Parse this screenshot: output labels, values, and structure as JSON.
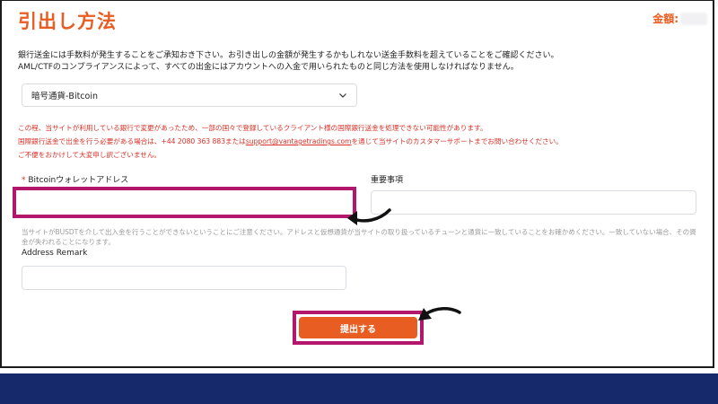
{
  "page": {
    "title": "引出し方法",
    "amount_label": "金額:"
  },
  "notice": {
    "line1": "銀行送金には手数料が発生することをご承知おき下さい。お引き出しの金額が発生するかもしれない送金手数料を超えていることをご確認ください。",
    "line2": "AML/CTFのコンプライアンスによって、すべての出金にはアカウントへの入金で用いられたものと同じ方法を使用しなければなりません。"
  },
  "method_select": {
    "value": "暗号通貨-Bitcoin",
    "icon": "chevron-down-icon"
  },
  "warning": {
    "line1": "この程、当サイトが利用している銀行で変更があったため、一部の国々で登録しているクライアント様の国際銀行送金を処理できない可能性があります。",
    "line2_prefix": "国際銀行送金で出金を行う必要がある場合は、+44 2080 363 883または",
    "email": "support@vantagetradings.com",
    "line2_suffix": "を通じて当サイトのカスタマーサポートまでお問い合わせください。",
    "line3": "ご不便をおかけして大変申し訳ございません。"
  },
  "form": {
    "wallet_required_mark": "*",
    "wallet_label": "Bitcoinウォレットアドレス",
    "wallet_value": "",
    "memo_label": "重要事項",
    "memo_value": "",
    "helper_text": "当サイトがBUSDTを介して出入金を行うことができないということにご注意ください。アドレスと仮想通貨が当サイトの取り扱っているチューンと通貨に一致していることをお確かめください。一致していない場合、その資金が失われることになります。",
    "remark_label": "Address Remark",
    "remark_value": "",
    "submit_label": "提出する"
  },
  "colors": {
    "accent": "#e85d22",
    "highlight": "#b3176c",
    "warning": "#d93026",
    "footer": "#16296a"
  }
}
